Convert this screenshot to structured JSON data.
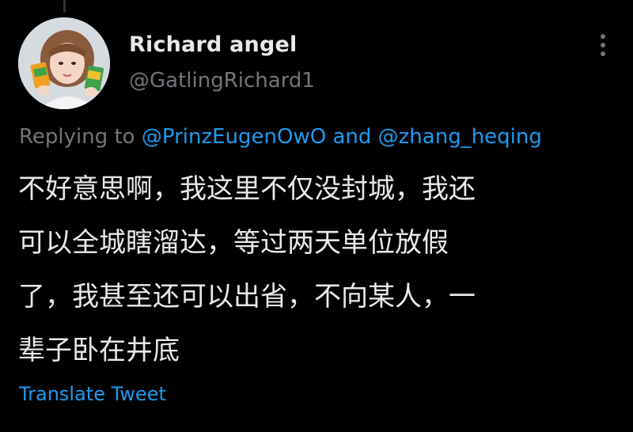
{
  "tweet": {
    "author": {
      "display_name": "Richard angel",
      "handle": "@GatlingRichard1",
      "avatar": "profile-photo-girl-holding-snack-boxes"
    },
    "reply": {
      "prefix": "Replying to",
      "mention_1": "@PrinzEugenOwO",
      "conjunction": "and",
      "mention_2": "@zhang_heqing"
    },
    "text_lines": [
      "不好意思啊，我这里不仅没封城，我还",
      "可以全城瞎溜达，等过两天单位放假",
      "了，我甚至还可以出省，不向某人，一",
      "辈子卧在井底"
    ],
    "translate_label": "Translate Tweet",
    "more_icon": "more-horizontal-icon"
  },
  "colors": {
    "background": "#000000",
    "primary_text": "#e7e9ea",
    "secondary_text": "#71767b",
    "accent": "#1d9bf0"
  }
}
